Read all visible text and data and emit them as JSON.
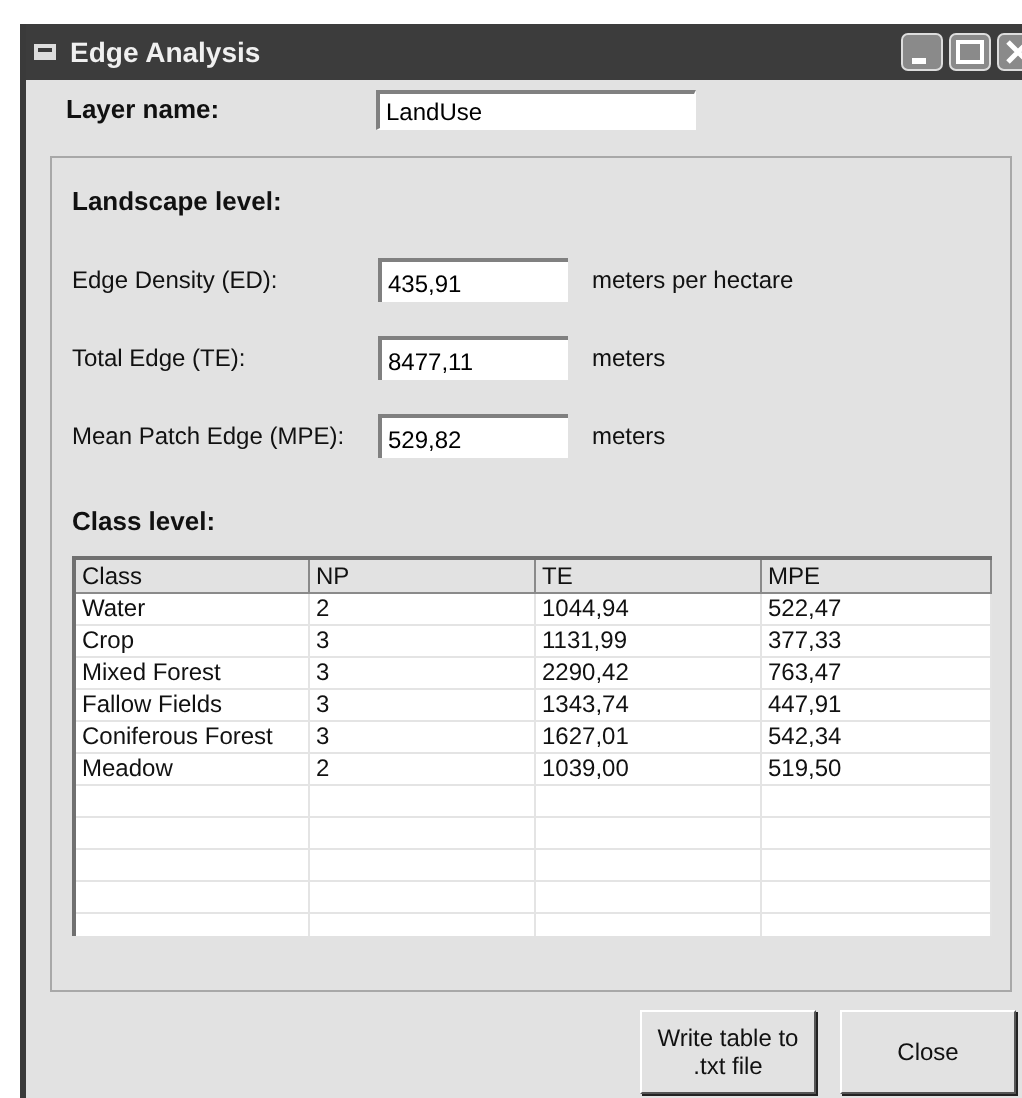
{
  "window": {
    "title": "Edge Analysis"
  },
  "layer": {
    "label": "Layer name:",
    "value": "LandUse"
  },
  "landscape": {
    "heading": "Landscape level:",
    "metrics": [
      {
        "label": "Edge Density (ED):",
        "value": "435,91",
        "unit": "meters per hectare"
      },
      {
        "label": "Total Edge (TE):",
        "value": "8477,11",
        "unit": "meters"
      },
      {
        "label": "Mean Patch Edge (MPE):",
        "value": "529,82",
        "unit": "meters"
      }
    ]
  },
  "class_level": {
    "heading": "Class level:",
    "table": {
      "columns": [
        "Class",
        "NP",
        "TE",
        "MPE"
      ],
      "rows": [
        [
          "Water",
          "2",
          "1044,94",
          "522,47"
        ],
        [
          "Crop",
          "3",
          "1131,99",
          "377,33"
        ],
        [
          "Mixed Forest",
          "3",
          "2290,42",
          "763,47"
        ],
        [
          "Fallow Fields",
          "3",
          "1343,74",
          "447,91"
        ],
        [
          "Coniferous Forest",
          "3",
          "1627,01",
          "542,34"
        ],
        [
          "Meadow",
          "2",
          "1039,00",
          "519,50"
        ]
      ]
    }
  },
  "buttons": [
    {
      "label": "Write table to .txt  file"
    },
    {
      "label": "Close"
    }
  ]
}
